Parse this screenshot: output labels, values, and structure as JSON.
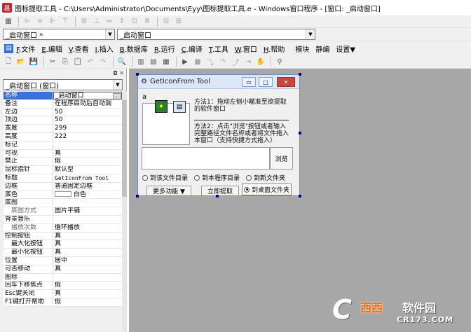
{
  "window": {
    "title": "图标提取工具 - C:\\Users\\Administrator\\Documents\\Eyy\\图标提取工具.e - Windows窗口程序 - [窗口: _启动窗口]",
    "app_icon_text": "易"
  },
  "toolbar": {
    "row1_icons": [
      "grid-icon",
      "align-left-icon",
      "align-center-icon",
      "align-right-icon",
      "align-top-icon",
      "align-middle-icon",
      "align-bottom-icon",
      "same-width-icon",
      "same-height-icon",
      "same-size-icon",
      "h-space-icon",
      "v-space-icon",
      "center-h-icon",
      "center-v-icon"
    ],
    "combo_left_value": "_启动窗口 *",
    "combo_right_value": "_启动窗口"
  },
  "menu": {
    "items": [
      {
        "key": "F",
        "label": ".文件"
      },
      {
        "key": "E",
        "label": ".编辑"
      },
      {
        "key": "V",
        "label": ".查看"
      },
      {
        "key": "I",
        "label": ".插入"
      },
      {
        "key": "B",
        "label": ".数据库"
      },
      {
        "key": "R",
        "label": ".运行"
      },
      {
        "key": "C",
        "label": ".编译"
      },
      {
        "key": "T",
        "label": ".工具"
      },
      {
        "key": "W",
        "label": ".窗口"
      },
      {
        "key": "H",
        "label": ".帮助"
      },
      {
        "key": "",
        "label": "模块"
      },
      {
        "key": "",
        "label": "静编"
      },
      {
        "key": "",
        "label": "设置▼"
      }
    ]
  },
  "panel": {
    "head_icons": "◘ ✕",
    "object_combo": "_启动窗口 (窗口)",
    "properties": [
      {
        "name": "名称",
        "value": "_启动窗口",
        "sel": true,
        "btn": "..."
      },
      {
        "name": "备注",
        "value": "在程序启动后自动调"
      },
      {
        "name": "左边",
        "value": "50"
      },
      {
        "name": "顶边",
        "value": "50"
      },
      {
        "name": "宽度",
        "value": "299"
      },
      {
        "name": "高度",
        "value": "222"
      },
      {
        "name": "标记",
        "value": ""
      },
      {
        "name": "可视",
        "value": "真"
      },
      {
        "name": "禁止",
        "value": "假"
      },
      {
        "name": "鼠标指针",
        "value": "默认型"
      },
      {
        "name": "标题",
        "value": "GetIconFrom Tool",
        "mono": true
      },
      {
        "name": "边框",
        "value": "普通固定边框"
      },
      {
        "name": "底色",
        "value": "白色",
        "swatch": true
      },
      {
        "name": "底图",
        "value": ""
      },
      {
        "name": "底图方式",
        "value": "图片平铺",
        "indent": true,
        "sub": true
      },
      {
        "name": "背景音乐",
        "value": ""
      },
      {
        "name": "播放次数",
        "value": "循环播放",
        "indent": true,
        "sub": true
      },
      {
        "name": "控制按钮",
        "value": "真"
      },
      {
        "name": "最大化按钮",
        "value": "真",
        "indent": true
      },
      {
        "name": "最小化按钮",
        "value": "真",
        "indent": true
      },
      {
        "name": "位置",
        "value": "居中"
      },
      {
        "name": "可否移动",
        "value": "真"
      },
      {
        "name": "图标",
        "value": ""
      },
      {
        "name": "回车下移焦点",
        "value": "假"
      },
      {
        "name": "Esc键关闭",
        "value": "真"
      },
      {
        "name": "F1键打开帮助",
        "value": "假"
      }
    ]
  },
  "form": {
    "title": "GetIconFrom Tool",
    "label_a": "a",
    "method1_line1": "方法1：拖动左侧小瞄准至欲提取",
    "method1_line2": "的软件窗口",
    "method2_line1": "方法2：点击\"浏览\"按钮或者输入",
    "method2_line2": "完整路径文件名称或者将文件拖入",
    "method2_line3": "本窗口（支持快捷方式拖入）",
    "browse_label": "浏览",
    "radio1": "到该文件目录",
    "radio2": "到本程序目录",
    "radio3": "到新文件夹",
    "radio4": "到桌面文件夹",
    "more_btn": "更多功能 ▼",
    "extract_btn": "立即提取"
  },
  "watermark": {
    "logo_text": "西西",
    "brand": "软件园",
    "url": "CR173.COM",
    "glyph": "C"
  }
}
